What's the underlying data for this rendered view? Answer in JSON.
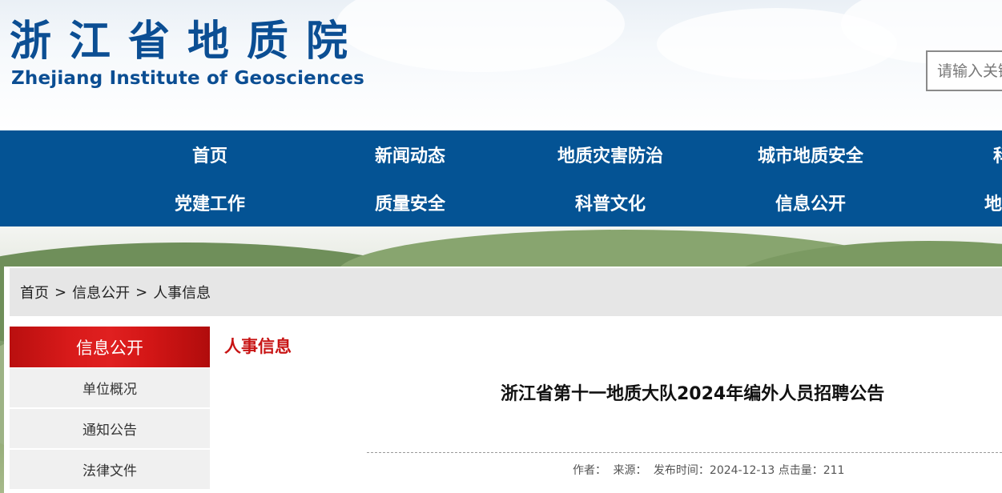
{
  "header": {
    "title_cn": "浙江省地质院",
    "title_en": "Zhejiang Institute of Geosciences",
    "search_placeholder": "请输入关键"
  },
  "nav": {
    "row1": [
      "首页",
      "新闻动态",
      "地质灾害防治",
      "城市地质安全",
      "科创"
    ],
    "row2": [
      "党建工作",
      "质量安全",
      "科普文化",
      "信息公开",
      "地质资"
    ]
  },
  "breadcrumb": {
    "items": [
      "首页",
      "信息公开",
      "人事信息"
    ],
    "separator": ">"
  },
  "sidebar": {
    "heading": "信息公开",
    "items": [
      "单位概况",
      "通知公告",
      "法律文件"
    ]
  },
  "main": {
    "section_title": "人事信息",
    "article_title": "浙江省第十一地质大队2024年编外人员招聘公告",
    "meta": {
      "author_label": "作者：",
      "source_label": "来源：",
      "date_label": "发布时间：",
      "date": "2024-12-13",
      "clicks_label": "点击量：",
      "clicks": "211"
    }
  },
  "colors": {
    "brand_blue": "#045394",
    "logo_blue": "#0b4e93",
    "accent_red": "#c81414",
    "breadcrumb_bg": "#e6e6e6"
  }
}
